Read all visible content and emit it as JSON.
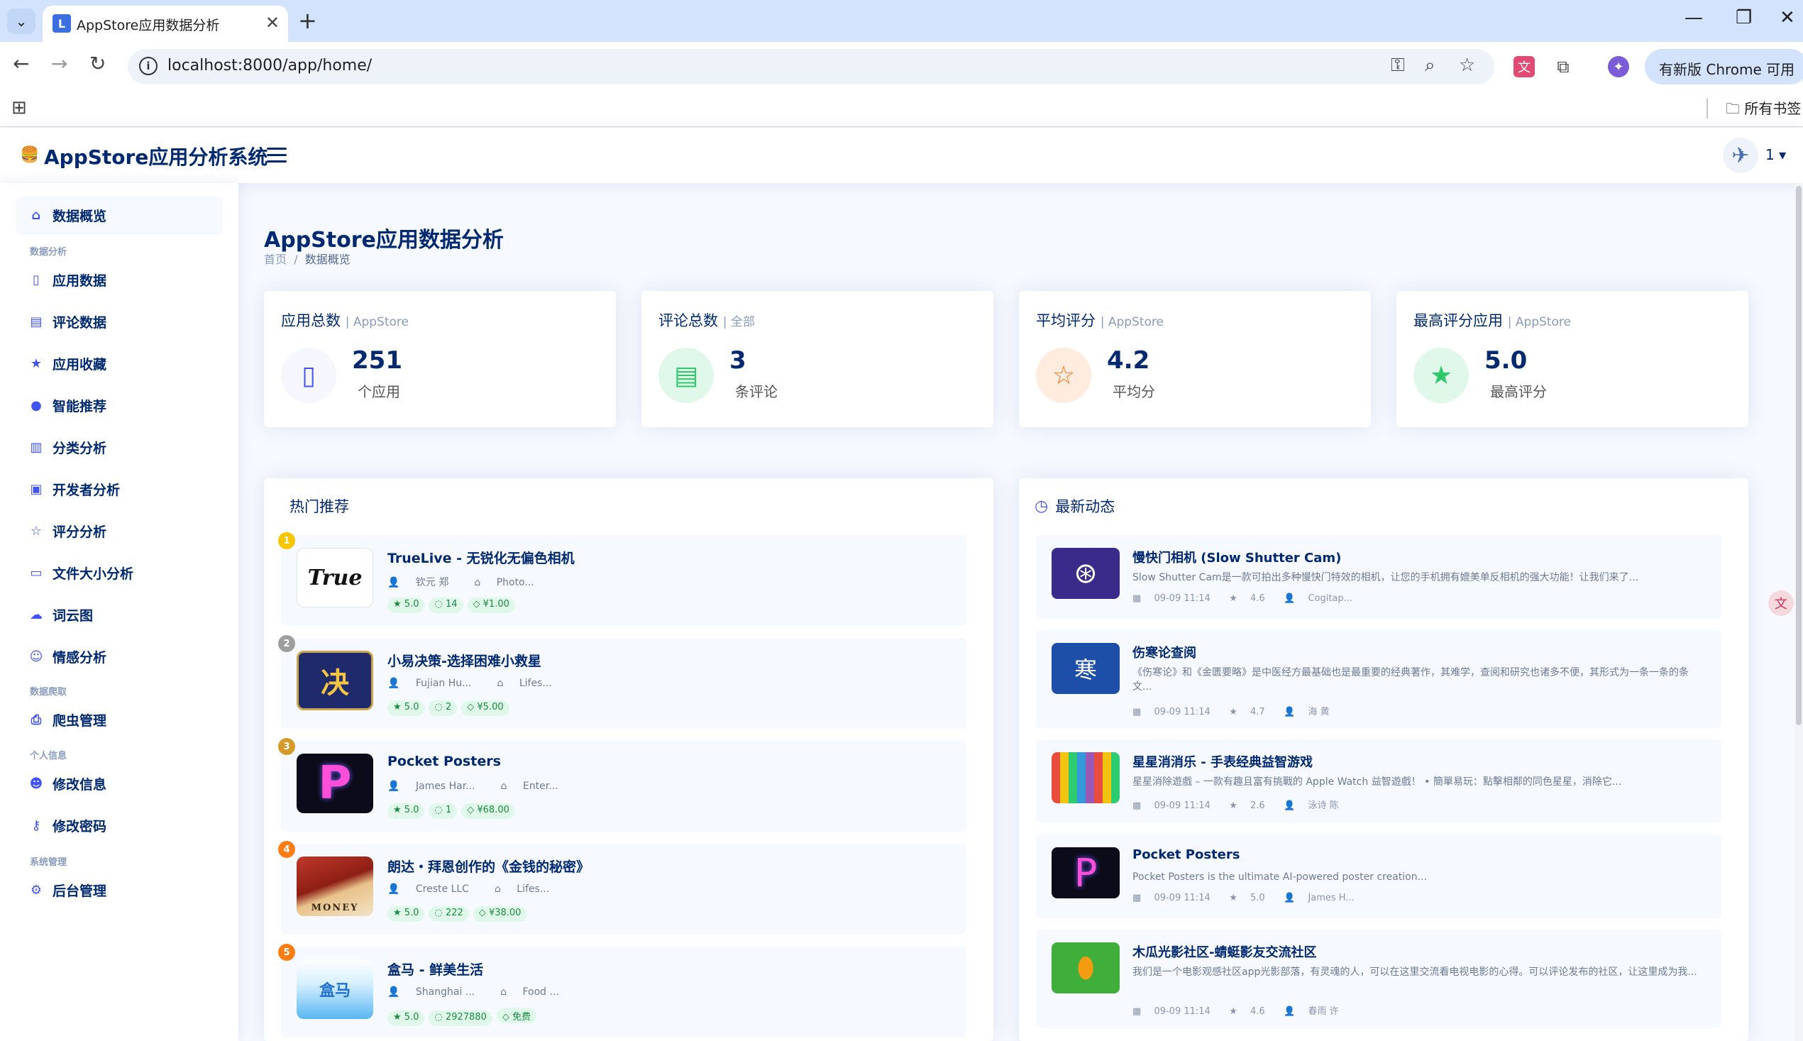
{
  "browser": {
    "tab_title": "AppStore应用数据分析",
    "url": "localhost:8000/app/home/",
    "update_button": "有新版 Chrome 可用",
    "bookmarks_folder": "所有书签"
  },
  "header": {
    "app_title": "AppStore应用分析系统",
    "user_name": "1"
  },
  "sidebar": {
    "overview": "数据概览",
    "sections": [
      {
        "heading": "数据分析",
        "items": [
          "应用数据",
          "评论数据",
          "应用收藏",
          "智能推荐",
          "分类分析",
          "开发者分析",
          "评分分析",
          "文件大小分析",
          "词云图",
          "情感分析"
        ]
      },
      {
        "heading": "数据爬取",
        "items": [
          "爬虫管理"
        ]
      },
      {
        "heading": "个人信息",
        "items": [
          "修改信息",
          "修改密码"
        ]
      },
      {
        "heading": "系统管理",
        "items": [
          "后台管理"
        ]
      }
    ]
  },
  "page": {
    "title": "AppStore应用数据分析",
    "breadcrumb_home": "首页",
    "breadcrumb_sep": "/",
    "breadcrumb_current": "数据概览"
  },
  "stats": [
    {
      "title": "应用总数",
      "sub": "| AppStore",
      "value": "251",
      "unit": "个应用",
      "icon": "phone-icon",
      "color": "#4154f1",
      "bg": "#f6f6fe"
    },
    {
      "title": "评论总数",
      "sub": "| 全部",
      "value": "3",
      "unit": "条评论",
      "icon": "comment-icon",
      "color": "#2eca6a",
      "bg": "#e0f8e9"
    },
    {
      "title": "平均评分",
      "sub": "| AppStore",
      "value": "4.2",
      "unit": "平均分",
      "icon": "star-outline-icon",
      "color": "#ff771d",
      "bg": "#ffecdf"
    },
    {
      "title": "最高评分应用",
      "sub": "| AppStore",
      "value": "5.0",
      "unit": "最高评分",
      "icon": "star-icon",
      "color": "#2eca6a",
      "bg": "#e0f8e9"
    }
  ],
  "hot": {
    "title": "热门推荐",
    "items": [
      {
        "rank": "1",
        "name": "TrueLive - 无锐化无偏色相机",
        "developer": "钦元 郑",
        "category": "Photo...",
        "rating": "5.0",
        "comments": "14",
        "price": "¥1.00",
        "icon_text": "True",
        "rank_color": "#f7c600"
      },
      {
        "rank": "2",
        "name": "小易决策-选择困难小救星",
        "developer": "Fujian Hu...",
        "category": "Lifes...",
        "rating": "5.0",
        "comments": "2",
        "price": "¥5.00",
        "icon_text": "决",
        "rank_color": "#9e9e9e"
      },
      {
        "rank": "3",
        "name": "Pocket Posters",
        "developer": "James Har...",
        "category": "Enter...",
        "rating": "5.0",
        "comments": "1",
        "price": "¥68.00",
        "icon_text": "P",
        "rank_color": "#d49a2a"
      },
      {
        "rank": "4",
        "name": "朗达・拜恩创作的《金钱的秘密》",
        "developer": "Creste LLC",
        "category": "Lifes...",
        "rating": "5.0",
        "comments": "222",
        "price": "¥38.00",
        "icon_text": "MONEY",
        "rank_color": "#fd7e14"
      },
      {
        "rank": "5",
        "name": "盒马 - 鲜美生活",
        "developer": "Shanghai ...",
        "category": "Food ...",
        "rating": "5.0",
        "comments": "2927880",
        "price": "免费",
        "icon_text": "盒马",
        "rank_color": "#fd7e14"
      }
    ]
  },
  "activity": {
    "title": "最新动态",
    "items": [
      {
        "name": "慢快门相机 (Slow Shutter Cam)",
        "desc": "Slow Shutter Cam是一款可拍出多种慢快门特效的相机，让您的手机拥有媲美单反相机的强大功能！让我们来了...",
        "time": "09-09 11:14",
        "rating": "4.6",
        "author": "Cogitap..."
      },
      {
        "name": "伤寒论查阅",
        "desc": "《伤寒论》和《金匮要略》是中医经方最基础也是最重要的经典著作，其难学，查阅和研究也诸多不便，其形式为一条一条的条文...",
        "time": "09-09 11:14",
        "rating": "4.7",
        "author": "海 黄"
      },
      {
        "name": "星星消消乐 - 手表经典益智游戏",
        "desc": "星星消除遊戲 – 一款有趣且富有挑戰的 Apple Watch 益智遊戲！ • 簡單易玩：點擊相鄰的同色星星，消除它...",
        "time": "09-09 11:14",
        "rating": "2.6",
        "author": "泳诗 陈"
      },
      {
        "name": "Pocket Posters",
        "desc": "Pocket Posters is the ultimate AI-powered poster creation...",
        "time": "09-09 11:14",
        "rating": "5.0",
        "author": "James H..."
      },
      {
        "name": "木瓜光影社区-蜻蜓影友交流社区",
        "desc": "我们是一个电影观感社区app光影部落，有灵魂的人，可以在这里交流看电视电影的心得。可以评论发布的社区，让这里成为我...",
        "time": "09-09 11:14",
        "rating": "4.6",
        "author": "春雨 许"
      }
    ]
  }
}
